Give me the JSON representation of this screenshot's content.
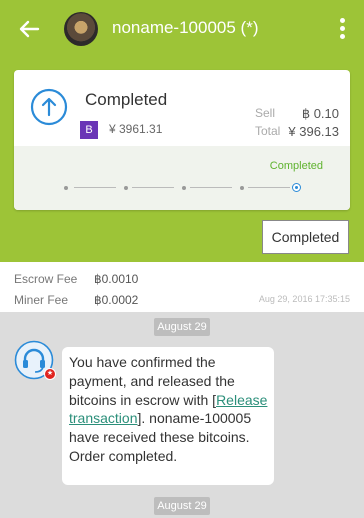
{
  "header": {
    "title": "noname-100005 (*)"
  },
  "order": {
    "status": "Completed",
    "coin_badge": "B",
    "price": "¥ 3961.31",
    "sell_label": "Sell",
    "sell_value": "฿ 0.10",
    "total_label": "Total",
    "total_value": "¥ 396.13",
    "progress_label": "Completed",
    "progress": {
      "current_step": 5,
      "total_steps": 5
    }
  },
  "actions": {
    "completed_button": "Completed"
  },
  "fees": {
    "escrow_label": "Escrow Fee",
    "escrow_value": "฿0.0010",
    "miner_label": "Miner Fee",
    "miner_value": "฿0.0002",
    "timestamp": "Aug 29, 2016 17:35:15"
  },
  "chat": {
    "date_1": "August 29",
    "message_prefix": "You have confirmed the payment, and released the bitcoins in escrow with [",
    "message_link": "Release transaction",
    "message_suffix": "]. noname-100005 have received these bitcoins. Order completed.",
    "date_2": "August 29"
  },
  "colors": {
    "brand_green": "#9dc437",
    "accent_blue": "#2b8bd8",
    "status_green": "#5fb32f",
    "coin_purple": "#6a35b6"
  }
}
